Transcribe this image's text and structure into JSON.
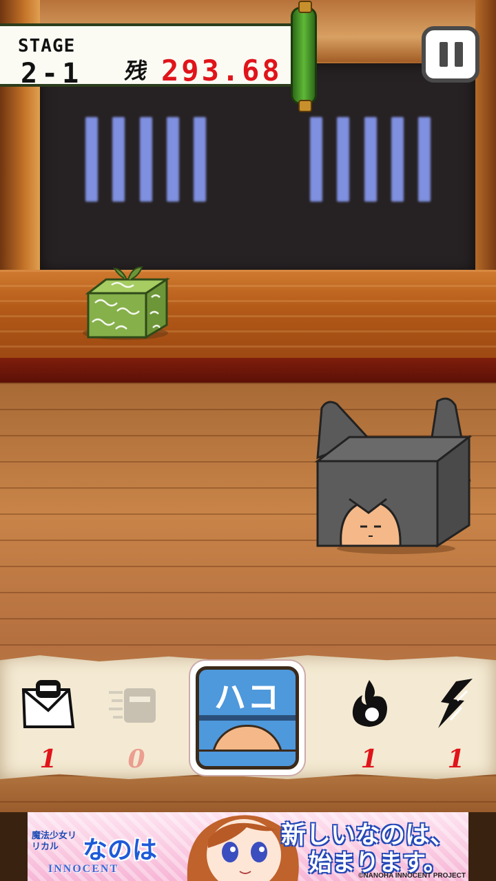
{
  "hud": {
    "stage_word": "STAGE",
    "stage_number": "2-1",
    "distance_label": "残",
    "distance_value": "293.68"
  },
  "controls": {
    "pause_icon": "pause-icon"
  },
  "items": [
    {
      "name": "ninja-envelope",
      "icon": "ninja-envelope-icon",
      "count": "1",
      "enabled": true
    },
    {
      "name": "ninja-dash",
      "icon": "ninja-dash-icon",
      "count": "0",
      "enabled": false
    },
    {
      "name": "box",
      "icon": "box-disguise-icon",
      "label": "ハコ",
      "selected": true
    },
    {
      "name": "fire",
      "icon": "fire-icon",
      "count": "1",
      "enabled": true
    },
    {
      "name": "lightning",
      "icon": "lightning-icon",
      "count": "1",
      "enabled": true
    }
  ],
  "banner": {
    "subtitle": "魔法少女リリカル",
    "logo": "なのは",
    "logo_sub": "INNOCENT",
    "tagline_1": "新しいなのは、",
    "tagline_2": "始まります。",
    "copyright": "©NANOHA INNOCENT PROJECT"
  },
  "colors": {
    "distance": "#e0141a",
    "count": "#e0141a",
    "box_item": "#4e98dc"
  }
}
